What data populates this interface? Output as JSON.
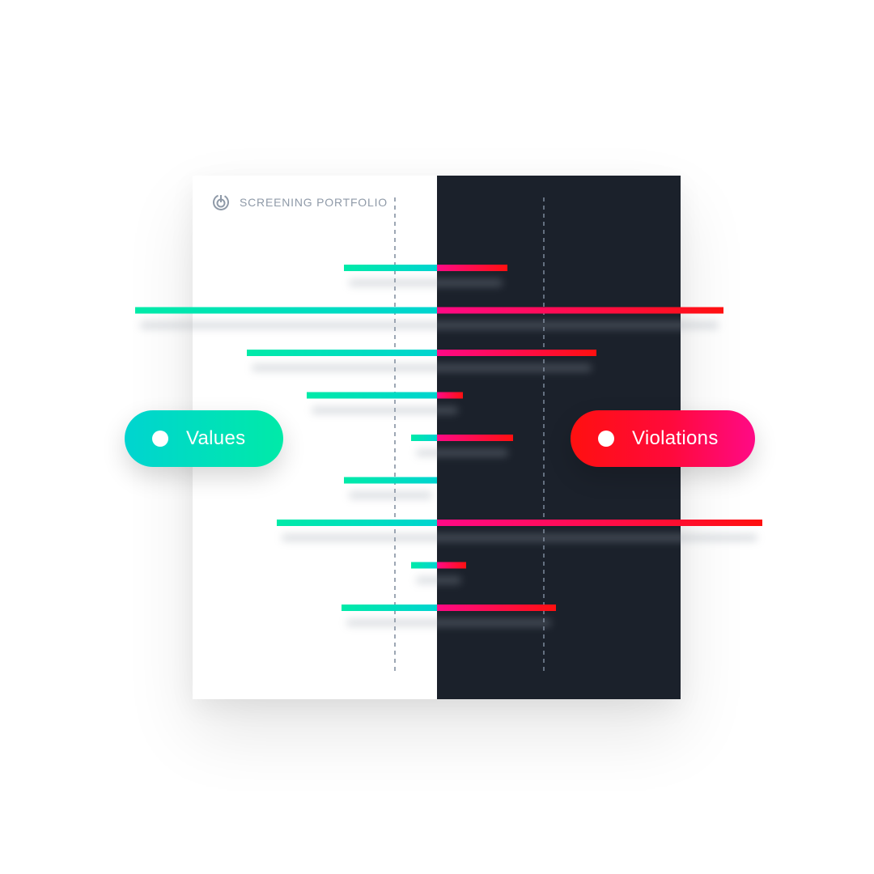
{
  "header": {
    "title": "SCREENING PORTFOLIO",
    "icon": "target-icon"
  },
  "legend": {
    "values_label": "Values",
    "violations_label": "Violations"
  },
  "colors": {
    "values_start": "#00d4d0",
    "values_end": "#00eaa8",
    "violations_start": "#ff0a86",
    "violations_end": "#ff1010",
    "dark_panel": "#1b212b",
    "guide_line": "#7d8a9c"
  },
  "chart_data": {
    "type": "bar",
    "orientation": "horizontal-diverging",
    "series": [
      {
        "name": "Values",
        "side": "left",
        "values": [
          115,
          373,
          235,
          161,
          32,
          115,
          198,
          32,
          118
        ]
      },
      {
        "name": "Violations",
        "side": "right",
        "values": [
          87,
          354,
          197,
          32,
          94,
          0,
          402,
          36,
          147
        ]
      }
    ],
    "reference_lines": [
      -52,
      132
    ],
    "grid": false,
    "legend_placement": "left-and-right"
  }
}
